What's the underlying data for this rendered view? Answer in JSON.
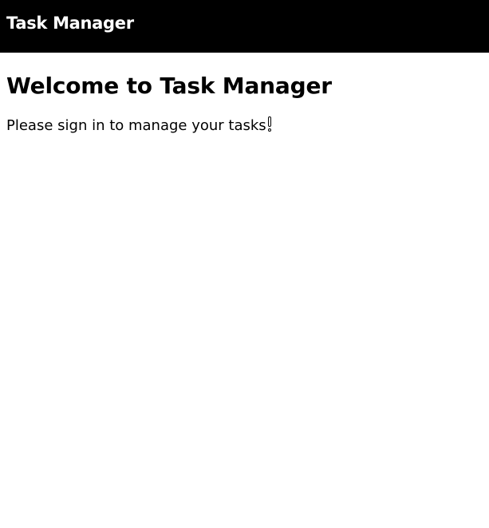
{
  "header": {
    "app_title": "Task Manager",
    "background_color": "#000000",
    "text_color": "#ffffff"
  },
  "main": {
    "heading": "Welcome to Task Manager",
    "message": "Please sign in to manage your tasks"
  },
  "icons": {
    "cursor": "text-cursor-icon"
  }
}
